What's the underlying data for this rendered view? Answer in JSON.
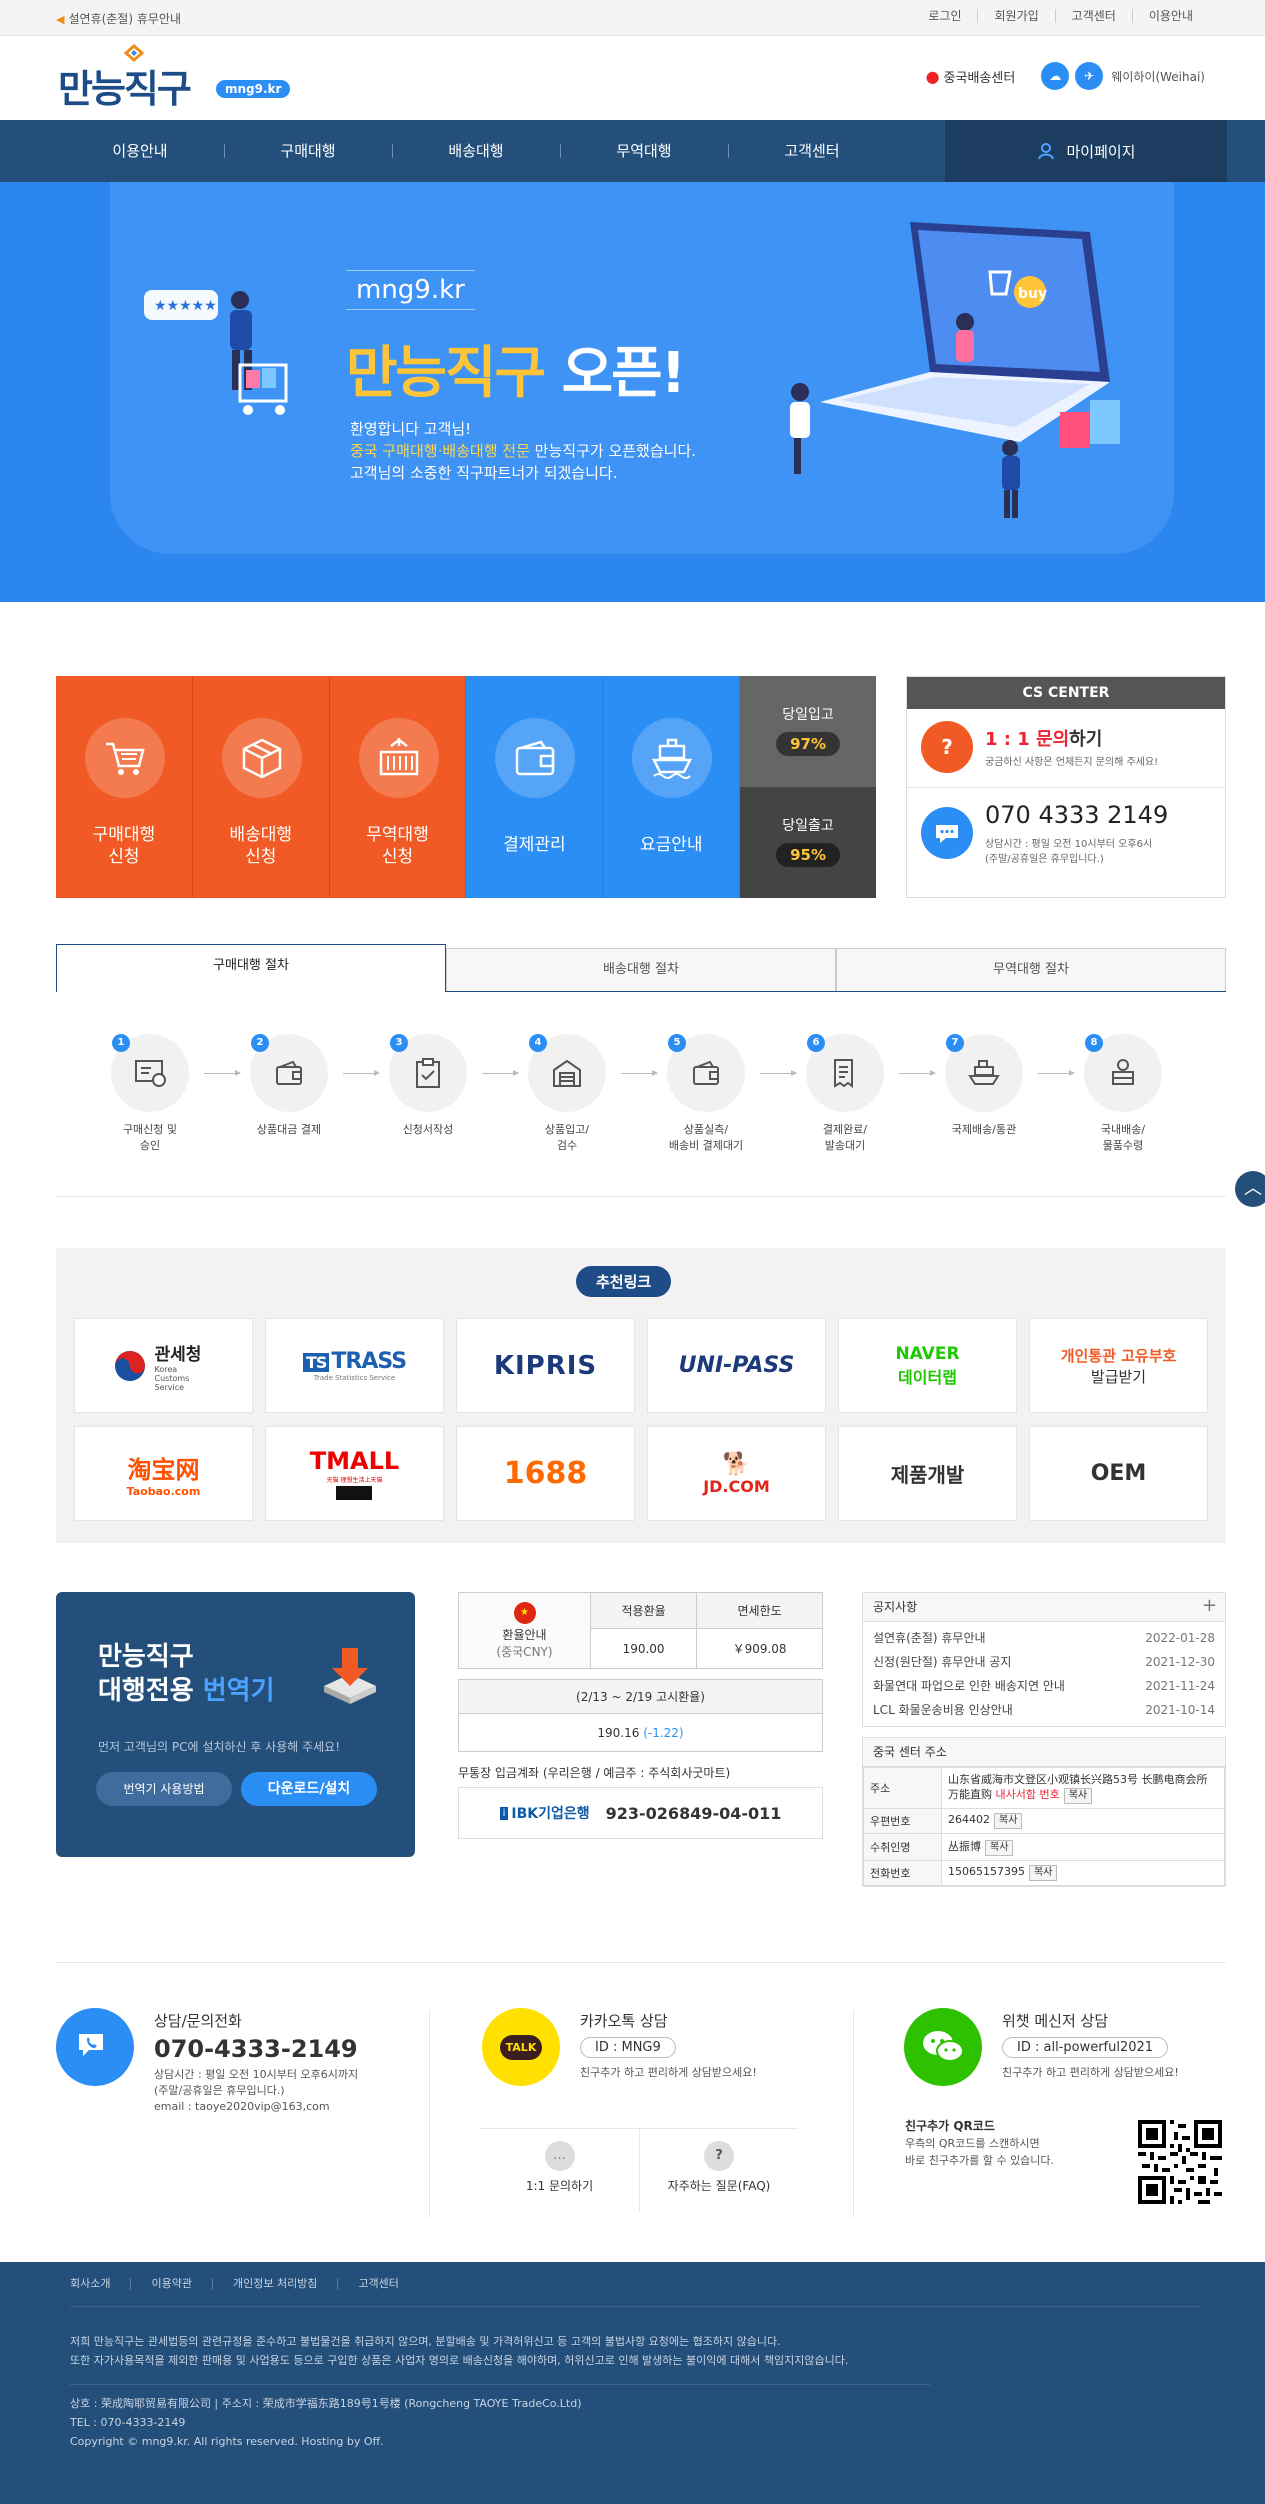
{
  "topbar": {
    "notice": "설연휴(춘절) 휴무안내",
    "links": [
      "로그인",
      "회원가입",
      "고객센터",
      "이용안내"
    ]
  },
  "header": {
    "logo_text": "만능직구",
    "logo_badge": "mng9.kr",
    "center_label": "중국배송센터",
    "location": "웨이하이(Weihai)"
  },
  "nav": {
    "items": [
      "이용안내",
      "구매대행",
      "배송대행",
      "무역대행",
      "고객센터"
    ],
    "mypage": "마이페이지"
  },
  "hero": {
    "domain": "mng9.kr",
    "title_accent": "만능직구",
    "title_rest": "오픈!",
    "line1": "환영합니다 고객님!",
    "line2_accent": "중국 구매대행·배송대행 전문",
    "line2_rest": " 만능직구가 오픈했습니다.",
    "line3": "고객님의 소중한 직구파트너가 되겠습니다."
  },
  "quick": {
    "buttons": [
      {
        "line1": "구매대행",
        "line2": "신청",
        "icon": "cart-icon",
        "color": "#f15a24"
      },
      {
        "line1": "배송대행",
        "line2": "신청",
        "icon": "box-icon",
        "color": "#f15a24"
      },
      {
        "line1": "무역대행",
        "line2": "신청",
        "icon": "container-icon",
        "color": "#f15a24"
      },
      {
        "line1": "결제관리",
        "line2": "",
        "icon": "wallet-icon",
        "color": "#2b8ef5"
      },
      {
        "line1": "요금안내",
        "line2": "",
        "icon": "ship-icon",
        "color": "#2b8ef5"
      }
    ],
    "stat1_label": "당일입고",
    "stat1_value": "97%",
    "stat2_label": "당일출고",
    "stat2_value": "95%"
  },
  "cs": {
    "title": "CS CENTER",
    "inquiry_accent": "1 : 1 문의",
    "inquiry_rest": "하기",
    "inquiry_sub": "궁금하신 사항은 언제든지 문의해 주세요!",
    "phone": "070 4333 2149",
    "hours1": "상담시간 : 평일 오전 10시부터 오후6시",
    "hours2": "(주말/공휴일은 휴무입니다.)"
  },
  "process_tabs": [
    "구매대행 절차",
    "배송대행 절차",
    "무역대행 절차"
  ],
  "steps": [
    {
      "num": "1",
      "l1": "구매신청 및",
      "l2": "승인",
      "icon": "order-icon"
    },
    {
      "num": "2",
      "l1": "상품대금 결제",
      "l2": "",
      "icon": "wallet-icon"
    },
    {
      "num": "3",
      "l1": "신청서작성",
      "l2": "",
      "icon": "clipboard-icon"
    },
    {
      "num": "4",
      "l1": "상품입고/",
      "l2": "검수",
      "icon": "warehouse-icon"
    },
    {
      "num": "5",
      "l1": "상품실측/",
      "l2": "배송비 결제대기",
      "icon": "wallet-icon"
    },
    {
      "num": "6",
      "l1": "결제완료/",
      "l2": "발송대기",
      "icon": "receipt-icon"
    },
    {
      "num": "7",
      "l1": "국제배송/통관",
      "l2": "",
      "icon": "ship-icon"
    },
    {
      "num": "8",
      "l1": "국내배송/",
      "l2": "물품수령",
      "icon": "delivery-icon"
    }
  ],
  "recommend": {
    "title": "추천링크",
    "row1": [
      "관세청",
      "TRASS",
      "KIPRIS",
      "UNI-PASS",
      "NAVER 데이터랩",
      "개인통관 고유부호 발급받기"
    ],
    "row2": [
      "淘宝网",
      "TMALL",
      "1688",
      "JD.COM",
      "제품개발",
      "OEM"
    ],
    "sub": {
      "customs": "Korea Customs Service",
      "trass": "Trade Statistics Service",
      "taobao": "Taobao.com",
      "tmall_sub": "天猫 理想生活上天猫",
      "naver_top": "NAVER",
      "naver_bottom": "데이터랩",
      "pcc_top": "개인통관 고유부호",
      "pcc_bottom": "발급받기"
    }
  },
  "translator": {
    "line1": "만능직구",
    "line2a": "대행전용 ",
    "line2b": "번역기",
    "desc": "먼저 고객님의 PC에 설치하신 후 사용해 주세요!",
    "btn_how": "번역기 사용방법",
    "btn_dl": "다운로드/설치"
  },
  "rate": {
    "currency_label": "환율안내",
    "currency_unit": "(중국CNY)",
    "col1": "적용환율",
    "col2": "면세한도",
    "applied": "190.00",
    "limit": "￥909.08",
    "period": "(2/13 ~ 2/19 고시환율)",
    "notice_rate": "190.16",
    "notice_change": "(-1.22)",
    "bank_label": "무통장 입금계좌 (우리은행 / 예금주 : 주식회사굿마트)",
    "bank_name": "IBK기업은행",
    "bank_account": "923-026849-04-011"
  },
  "notices": {
    "title": "공지사항",
    "items": [
      {
        "t": "설연휴(춘절) 휴무안내",
        "d": "2022-01-28"
      },
      {
        "t": "신정(원단절) 휴무안내 공지",
        "d": "2021-12-30"
      },
      {
        "t": "화물연대 파업으로 인한 배송지연 안내",
        "d": "2021-11-24"
      },
      {
        "t": "LCL 화물운송비용 인상안내",
        "d": "2021-10-14"
      }
    ]
  },
  "address": {
    "title": "중국 센터 주소",
    "addr_label": "주소",
    "addr_value": "山东省威海市文登区小观镇长兴路53号 长鹏电商会所 万能直购",
    "addr_warn": "내사서함 번호",
    "zip_label": "우편번호",
    "zip_value": "264402",
    "recv_label": "수취인명",
    "recv_value": "丛振博",
    "tel_label": "전화번호",
    "tel_value": "15065157395",
    "copy": "복사"
  },
  "contact": {
    "phone_title": "상담/문의전화",
    "phone_num": "070-4333-2149",
    "phone_h1": "상담시간 : 평일 오전 10시부터 오후6시까지",
    "phone_h2": "(주말/공휴일은 휴무입니다.)",
    "phone_email": "email : taoye2020vip@163,com",
    "kakao_title": "카카오톡 상담",
    "kakao_id": "ID : MNG9",
    "kakao_desc": "친구추가 하고 편리하게 상담받으세요!",
    "kakao_badge": "TALK",
    "inq_label": "1:1 문의하기",
    "faq_label": "자주하는 질문(FAQ)",
    "wechat_title": "위챗 메신저 상담",
    "wechat_id": "ID : all-powerful2021",
    "wechat_desc": "친구추가 하고 편리하게 상담받으세요!",
    "qr_title": "친구추가 QR코드",
    "qr_l1": "우측의 QR코드를 스캔하시면",
    "qr_l2": "바로 친구추가를 할 수 있습니다."
  },
  "footer": {
    "links": [
      "회사소개",
      "이용약관",
      "개인정보 처리방침",
      "고객센터"
    ],
    "p1": "저희 만능직구는 관세법등의 관련규정을 준수하고 불법물건을 취급하지 않으며, 분할배송 및 가격허위신고 등 고객의 불법사항 요청에는 협조하지 않습니다.",
    "p2": "또한 자가사용목적을 제외한 판매용 및 사업용도 등으로 구입한 상품은 사업자 명의로 배송신청을 해야하며, 허위신고로 인해 발생하는 불이익에 대해서 책임지지않습니다.",
    "company": "상호 : 荣成陶耶贸易有限公司  |  주소지 : 荣成市学福东路189号1号楼 (Rongcheng TAOYE TradeCo.Ltd)",
    "tel": "TEL : 070-4333-2149",
    "copyright": "Copyright © mng9.kr. All rights reserved. Hosting by Off."
  }
}
